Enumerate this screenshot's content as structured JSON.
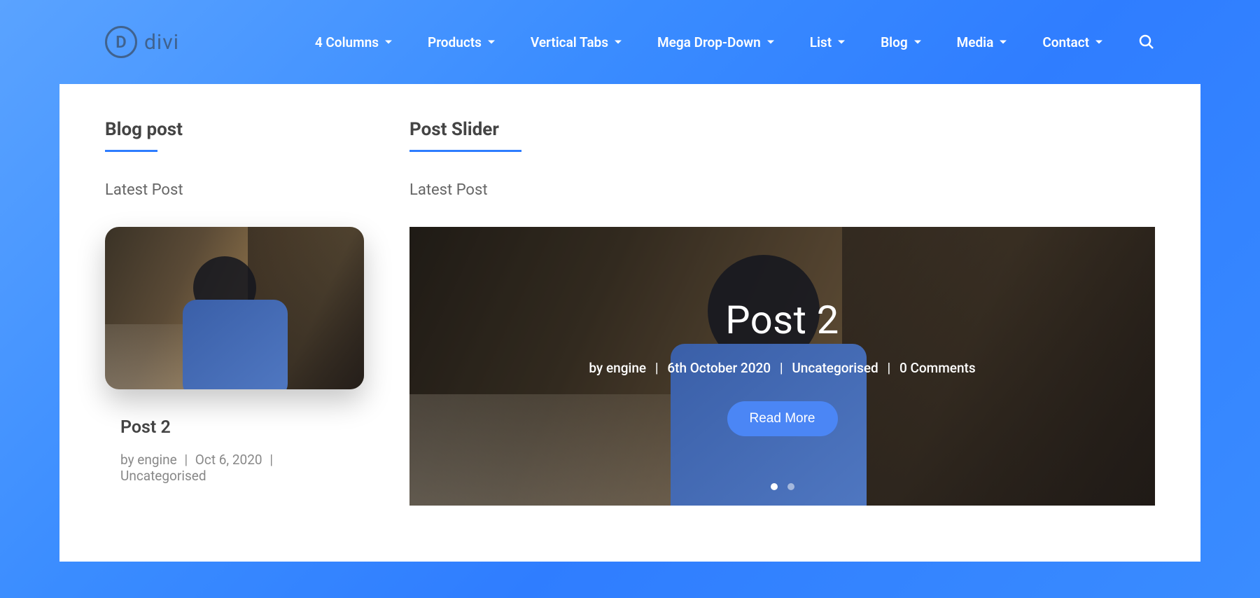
{
  "brand": {
    "name": "divi",
    "letter": "D"
  },
  "nav": {
    "items": [
      {
        "label": "4 Columns"
      },
      {
        "label": "Products"
      },
      {
        "label": "Vertical Tabs"
      },
      {
        "label": "Mega Drop-Down"
      },
      {
        "label": "List"
      },
      {
        "label": "Blog"
      },
      {
        "label": "Media"
      },
      {
        "label": "Contact"
      }
    ]
  },
  "left": {
    "section_title": "Blog post",
    "latest_label": "Latest Post",
    "post": {
      "title": "Post 2",
      "by_label": "by",
      "author": "engine",
      "date": "Oct 6, 2020",
      "category": "Uncategorised"
    }
  },
  "right": {
    "section_title": "Post Slider",
    "latest_label": "Latest Post",
    "slide": {
      "title": "Post 2",
      "by_label": "by",
      "author": "engine",
      "date": "6th October 2020",
      "category": "Uncategorised",
      "comments": "0 Comments",
      "read_more": "Read More"
    }
  }
}
